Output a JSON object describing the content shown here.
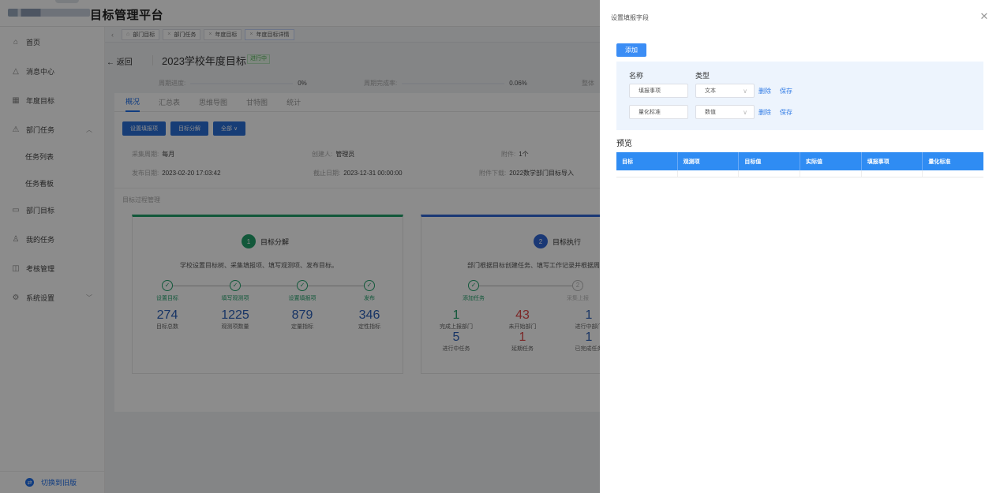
{
  "app": {
    "title": "目标管理平台"
  },
  "sidebar": {
    "items": [
      {
        "label": "首页",
        "icon": "home-icon"
      },
      {
        "label": "消息中心",
        "icon": "bell-icon"
      },
      {
        "label": "年度目标",
        "icon": "calendar-icon"
      },
      {
        "label": "部门任务",
        "icon": "department-icon"
      },
      {
        "label": "任务列表"
      },
      {
        "label": "任务看板"
      },
      {
        "label": "部门目标",
        "icon": "target-icon"
      },
      {
        "label": "我的任务",
        "icon": "user-icon"
      },
      {
        "label": "考核管理",
        "icon": "book-icon"
      },
      {
        "label": "系统设置",
        "icon": "settings-icon"
      }
    ],
    "switch_label": "切换到旧版"
  },
  "tabs": [
    "部门目标",
    "部门任务",
    "年度目标",
    "年度目标详情"
  ],
  "detail": {
    "back_label": "返回",
    "title": "2023学校年度目标",
    "status": "进行中",
    "progress": {
      "label": "周期进度:",
      "value": "0%"
    },
    "completion": {
      "label": "周期完成率:",
      "value": "0.06%"
    },
    "third_label": "整体",
    "subtabs": [
      "概况",
      "汇总表",
      "思维导图",
      "甘特图",
      "统计"
    ],
    "buttons": [
      "设置填报项",
      "目标分解",
      "全部 ∨"
    ],
    "info": {
      "cycle_label": "采集周期:",
      "cycle_value": "每月",
      "creator_label": "创建人:",
      "creator_value": "管理员",
      "attach_label": "附件:",
      "attach_value": "1个",
      "publish_label": "发布日期:",
      "publish_value": "2023-02-20 17:03:42",
      "deadline_label": "截止日期:",
      "deadline_value": "2023-12-31 00:00:00",
      "download_label": "附件下载:",
      "download_value": "2022数学部门目标导入"
    },
    "section_title": "目标过程管理",
    "phase1": {
      "num": "1",
      "title": "目标分解",
      "desc": "学校设置目标树、采集填报项、填写观测项、发布目标。",
      "steps": [
        "设置目标",
        "填写观测项",
        "设置填报项",
        "发布"
      ],
      "stats": [
        {
          "value": "274",
          "caption": "目标总数"
        },
        {
          "value": "1225",
          "caption": "观测项数量"
        },
        {
          "value": "879",
          "caption": "定量指标"
        },
        {
          "value": "346",
          "caption": "定性指标"
        }
      ]
    },
    "phase2": {
      "num": "2",
      "title": "目标执行",
      "desc": "部门根据目标创建任务、填写工作记录并根据周期",
      "steps": [
        "添加任务",
        "采集上报"
      ],
      "step2_num": "2",
      "stats_row1": [
        {
          "value": "1",
          "caption": "完成上报部门"
        },
        {
          "value": "43",
          "caption": "未开始部门"
        },
        {
          "value": "1",
          "caption": "进行中部门"
        }
      ],
      "stats_row2": [
        {
          "value": "5",
          "caption": "进行中任务"
        },
        {
          "value": "1",
          "caption": "延期任务"
        },
        {
          "value": "1",
          "caption": "已完成任务"
        }
      ]
    }
  },
  "drawer": {
    "title": "设置填报字段",
    "add_label": "添加",
    "col_name": "名称",
    "col_type": "类型",
    "fields": [
      {
        "name": "填报事项",
        "type": "文本",
        "delete": "删除",
        "save": "保存"
      },
      {
        "name": "量化标准",
        "type": "数值",
        "delete": "删除",
        "save": "保存"
      }
    ],
    "preview_title": "预览",
    "preview_columns": [
      "目标",
      "观测项",
      "目标值",
      "实际值",
      "填报事项",
      "量化标准"
    ]
  },
  "colors": {
    "primary": "#2f8cf3",
    "green": "#22a06b",
    "red": "#e04848"
  }
}
